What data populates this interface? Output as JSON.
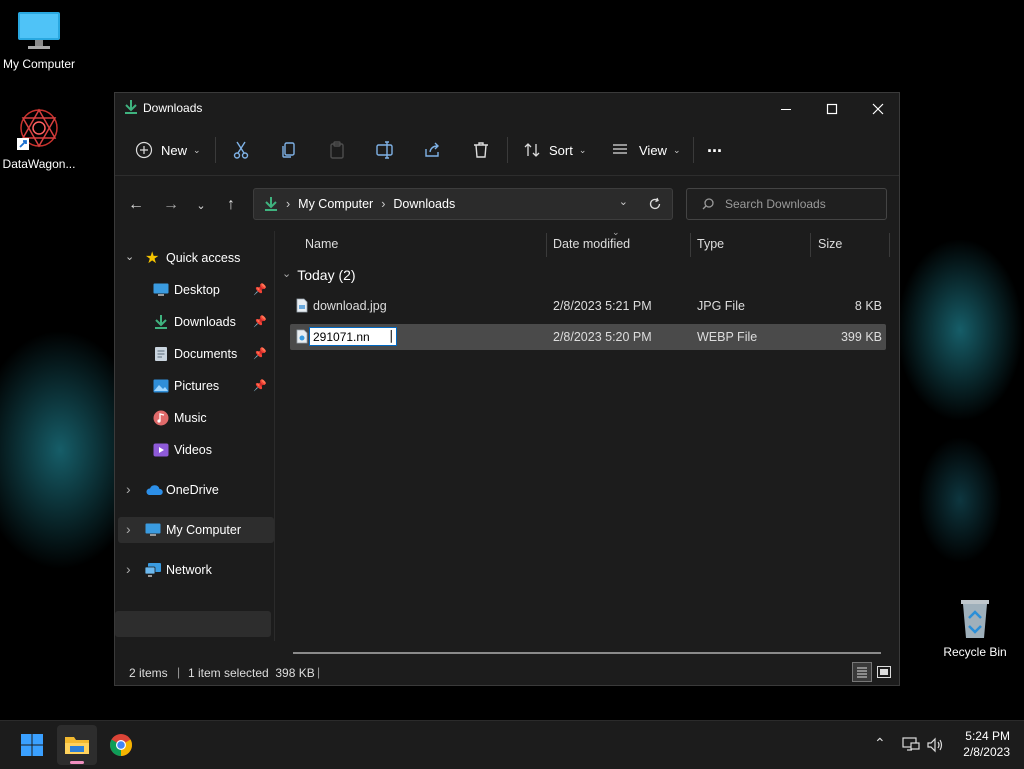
{
  "desktop": {
    "icons": [
      {
        "label": "My Computer"
      },
      {
        "label": "DataWagon..."
      },
      {
        "label": "Recycle Bin"
      }
    ]
  },
  "window": {
    "title": "Downloads",
    "toolbar": {
      "new_label": "New",
      "sort_label": "Sort",
      "view_label": "View",
      "more_label": "..."
    },
    "address": {
      "crumbs": [
        "My Computer",
        "Downloads"
      ],
      "search_placeholder": "Search Downloads"
    },
    "sidebar": {
      "quick_access": "Quick access",
      "items": [
        {
          "label": "Desktop",
          "icon": "desktop-icon",
          "pinned": true
        },
        {
          "label": "Downloads",
          "icon": "download-icon",
          "pinned": true
        },
        {
          "label": "Documents",
          "icon": "documents-icon",
          "pinned": true
        },
        {
          "label": "Pictures",
          "icon": "pictures-icon",
          "pinned": true
        },
        {
          "label": "Music",
          "icon": "music-icon",
          "pinned": false
        },
        {
          "label": "Videos",
          "icon": "videos-icon",
          "pinned": false
        }
      ],
      "onedrive": "OneDrive",
      "mycomputer": "My Computer",
      "network": "Network"
    },
    "content": {
      "columns": [
        "Name",
        "Date modified",
        "Type",
        "Size"
      ],
      "group_label": "Today (2)",
      "files": [
        {
          "name": "download.jpg",
          "date": "2/8/2023 5:21 PM",
          "type": "JPG File",
          "size": "8 KB",
          "selected": false
        },
        {
          "name": "291071.nn",
          "date": "2/8/2023 5:20 PM",
          "type": "WEBP File",
          "size": "399 KB",
          "selected": true,
          "renaming": true
        }
      ]
    },
    "status": {
      "items": "2 items",
      "selection": "1 item selected  398 KB"
    }
  },
  "taskbar": {
    "time": "5:24 PM",
    "date": "2/8/2023"
  },
  "colors": {
    "accent": "#0067c0",
    "window_bg": "#1c1c1c",
    "selected_row": "#4a4a4a",
    "download_green": "#3fb37f"
  }
}
